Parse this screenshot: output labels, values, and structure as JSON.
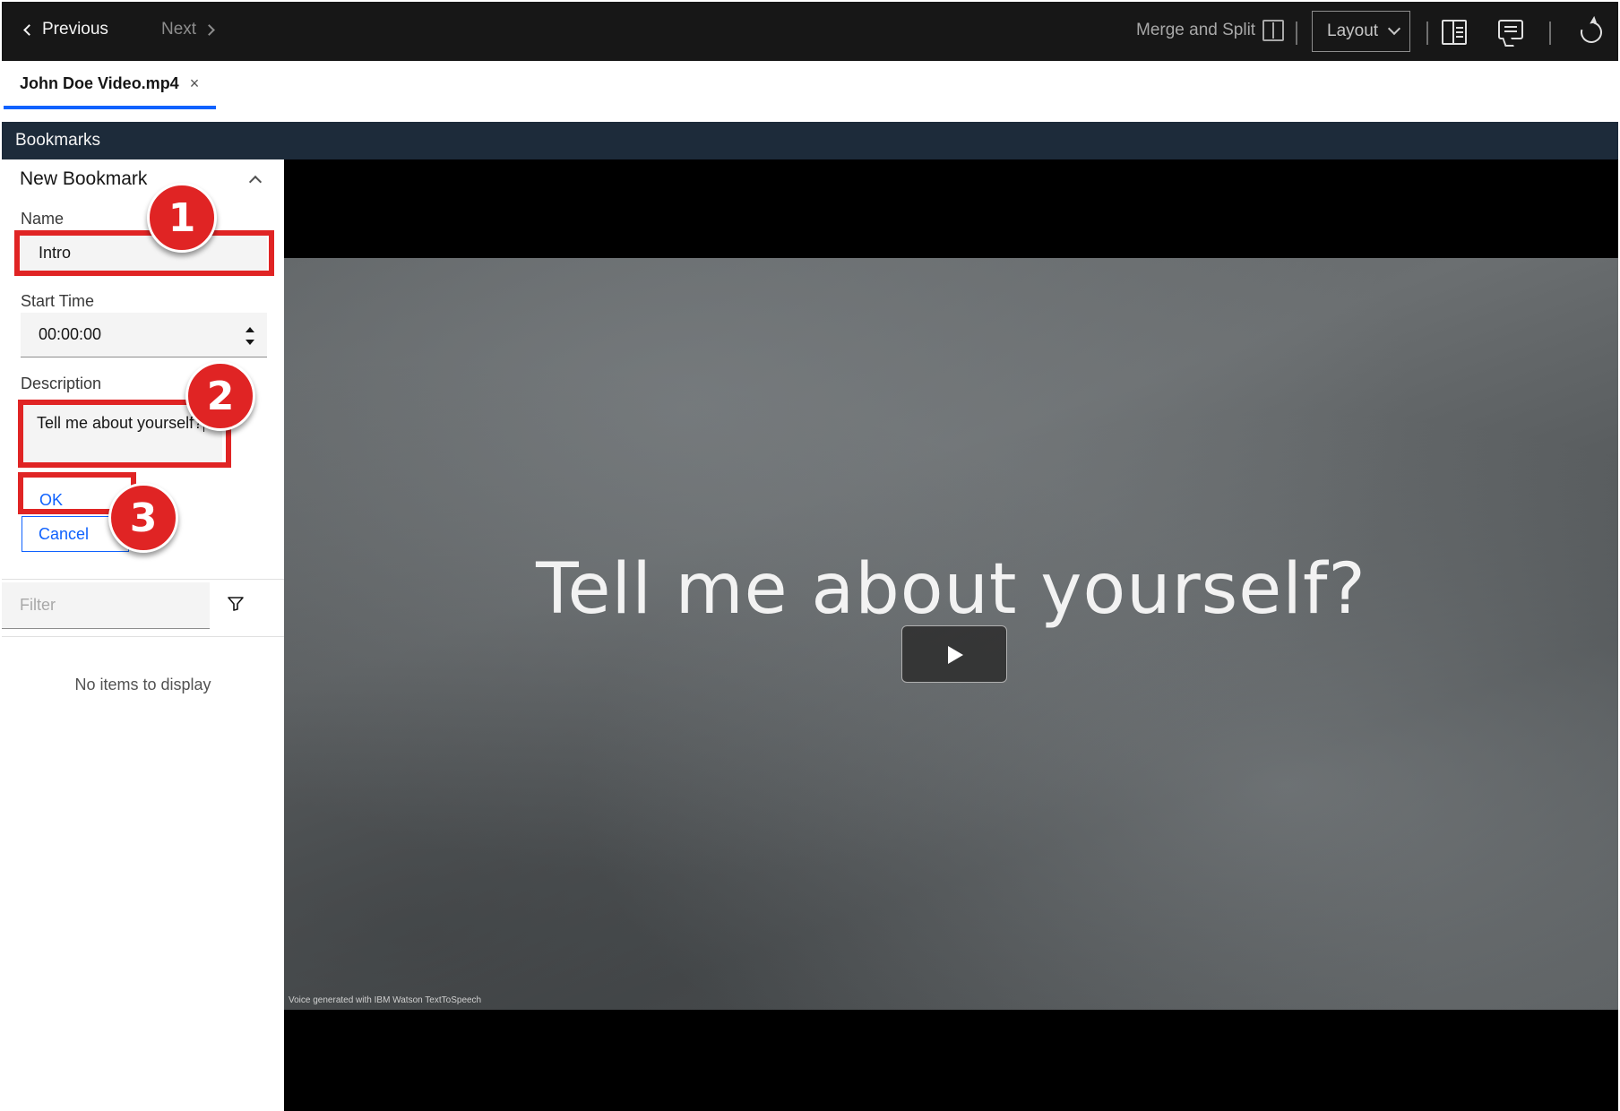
{
  "topbar": {
    "previous_label": "Previous",
    "next_label": "Next",
    "merge_label": "Merge and Split",
    "layout_label": "Layout"
  },
  "tabs": [
    {
      "title": "John Doe Video.mp4",
      "close": "×"
    }
  ],
  "bookmarks_header": "Bookmarks",
  "new_bookmark": {
    "title": "New Bookmark",
    "name_label": "Name",
    "name_value": "Intro",
    "start_time_label": "Start Time",
    "start_time_value": "00:00:00",
    "description_label": "Description",
    "description_value": "Tell me about yourself?",
    "ok_label": "OK",
    "cancel_label": "Cancel"
  },
  "filter": {
    "placeholder": "Filter",
    "empty_message": "No items to display"
  },
  "video": {
    "slide_text": "Tell me about yourself?",
    "credit": "Voice  generated with  IBM Watson TextToSpeech"
  },
  "callouts": [
    "1",
    "2",
    "3"
  ],
  "colors": {
    "accent": "#0f62fe",
    "topbar": "#171717",
    "bookmarks_bar": "#1d2b3a",
    "callout": "#e02424"
  },
  "icons": [
    "chevron-left-icon",
    "chevron-right-icon",
    "merge-split-icon",
    "chevron-down-icon",
    "side-panel-icon",
    "comment-icon",
    "refresh-icon",
    "close-icon",
    "chevron-up-icon",
    "stepper-icon",
    "filter-icon",
    "play-icon"
  ]
}
